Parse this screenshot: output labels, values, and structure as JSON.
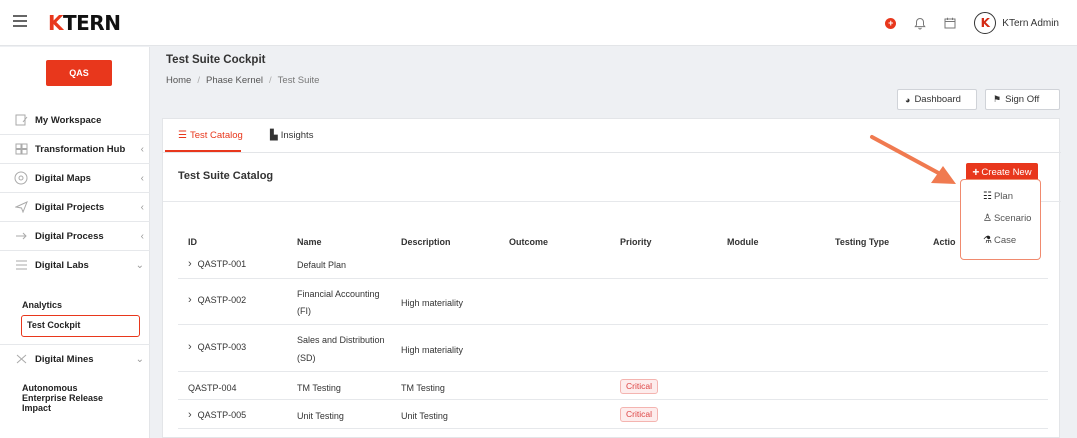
{
  "header": {
    "logo_prefix": "K",
    "logo_text": "TERN",
    "notification_badge": "+",
    "username": "KTern Admin",
    "avatar_letter": "K"
  },
  "sidebar": {
    "system": "QAS",
    "items": [
      {
        "label": "My Workspace"
      },
      {
        "label": "Transformation Hub"
      },
      {
        "label": "Digital Maps"
      },
      {
        "label": "Digital Projects"
      },
      {
        "label": "Digital Process"
      },
      {
        "label": "Digital Labs"
      },
      {
        "label": "Digital Mines"
      }
    ],
    "labs_sub": [
      "Analytics",
      "Test Cockpit"
    ],
    "mines_sub": "Autonomous Enterprise Release Impact"
  },
  "page": {
    "title": "Test Suite Cockpit",
    "breadcrumb": [
      "Home",
      "Phase Kernel",
      "Test Suite"
    ],
    "dashboard_label": "Dashboard",
    "signoff_label": "Sign Off"
  },
  "tabs": [
    {
      "label": "Test Catalog",
      "active": true
    },
    {
      "label": "Insights",
      "active": false
    }
  ],
  "catalog": {
    "title": "Test Suite Catalog",
    "create_label": "Create New",
    "menu": [
      "Plan",
      "Scenario",
      "Case"
    ]
  },
  "table": {
    "columns": [
      "ID",
      "Name",
      "Description",
      "Outcome",
      "Priority",
      "Module",
      "Testing Type",
      "Actio"
    ],
    "rows": [
      {
        "id": "QASTP-001",
        "name": "Default Plan",
        "description": "",
        "priority": "",
        "expandable": true
      },
      {
        "id": "QASTP-002",
        "name": "Financial Accounting (FI)",
        "name_l1": "Financial Accounting",
        "name_l2": "(FI)",
        "description": "High materiality",
        "priority": "",
        "expandable": true
      },
      {
        "id": "QASTP-003",
        "name": "Sales and Distribution (SD)",
        "name_l1": "Sales and Distribution",
        "name_l2": "(SD)",
        "description": "High materiality",
        "priority": "",
        "expandable": true
      },
      {
        "id": "QASTP-004",
        "name": "TM Testing",
        "description": "TM Testing",
        "priority": "Critical",
        "expandable": false
      },
      {
        "id": "QASTP-005",
        "name": "Unit Testing",
        "description": "Unit Testing",
        "priority": "Critical",
        "expandable": true
      }
    ]
  },
  "colors": {
    "accent": "#e8371c",
    "annotation_arrow": "#f07a50"
  }
}
